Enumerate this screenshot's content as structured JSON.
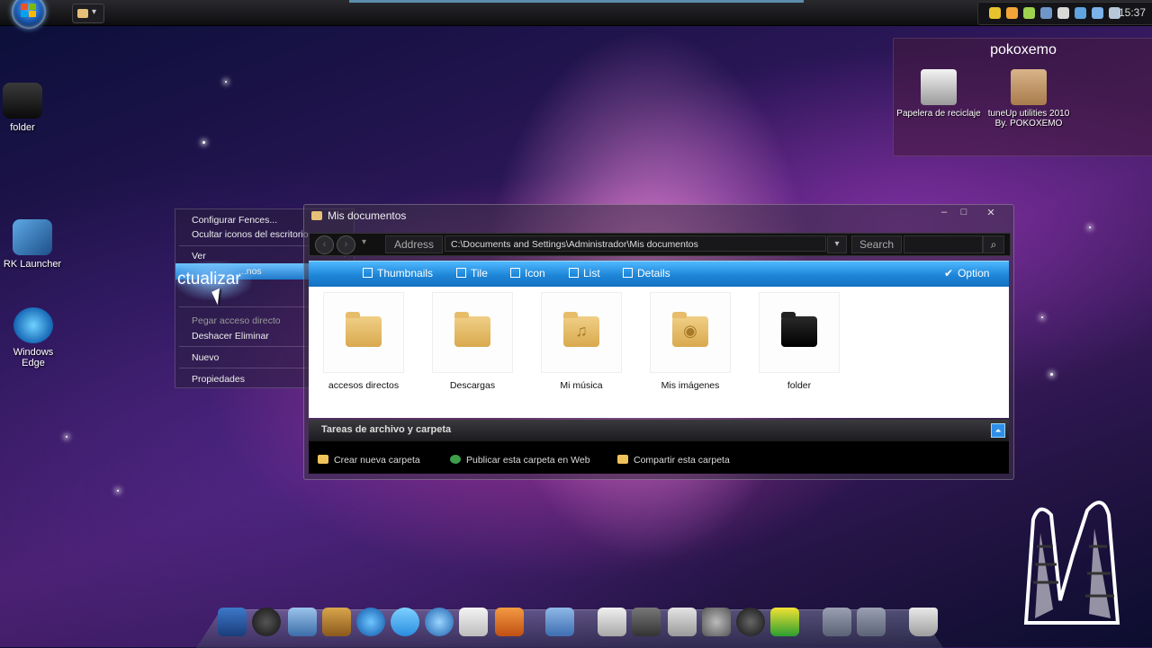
{
  "taskbar": {
    "start_icon": "windows-start-orb",
    "quick_launch_icon": "folder-icon",
    "tray_icons": [
      "shield-icon",
      "network-icon",
      "star-icon",
      "speaker-icon",
      "skype-icon",
      "chrome-icon",
      "flag-icon",
      "monitor-icon"
    ],
    "clock": "15:37"
  },
  "desktop": {
    "icons": [
      {
        "label": "folder",
        "icon": "apple-folder-icon"
      },
      {
        "label": "RK Launcher",
        "icon": "rk-launcher-icon"
      },
      {
        "label": "Windows Edge",
        "icon": "windows-edge-icon"
      }
    ]
  },
  "fence": {
    "title": "pokoxemo",
    "items": [
      {
        "label": "Papelera de reciclaje",
        "icon": "recycle-bin-icon"
      },
      {
        "label": "tuneUp utilities 2010",
        "label2": "By. POKOXEMO",
        "icon": "package-icon"
      }
    ]
  },
  "context_menu": {
    "items": [
      {
        "label": "Configurar Fences..."
      },
      {
        "label": "Ocultar iconos del escritorio"
      },
      {
        "label": "Ver"
      },
      {
        "label": "...nos"
      },
      {
        "label": "Pegar acceso directo"
      },
      {
        "label": "Deshacer Eliminar"
      },
      {
        "label": "Nuevo"
      },
      {
        "label": "Propiedades"
      }
    ],
    "overlay_text": "ctualizar"
  },
  "explorer": {
    "title": "Mis documentos",
    "window_buttons": {
      "minimize": "–",
      "maximize": "□",
      "close": "✕"
    },
    "address_label": "Address",
    "address_value": "C:\\Documents and Settings\\Administrador\\Mis documentos",
    "search_label": "Search",
    "views": [
      {
        "label": "Thumbnails",
        "icon": "thumbnails-icon"
      },
      {
        "label": "Tile",
        "icon": "tile-icon"
      },
      {
        "label": "Icon",
        "icon": "icon-view-icon"
      },
      {
        "label": "List",
        "icon": "list-icon"
      },
      {
        "label": "Details",
        "icon": "details-icon"
      }
    ],
    "option_label": "Option",
    "files": [
      {
        "label": "accesos directos",
        "icon": "folder-icon"
      },
      {
        "label": "Descargas",
        "icon": "folder-icon"
      },
      {
        "label": "Mi música",
        "icon": "music-folder-icon"
      },
      {
        "label": "Mis imágenes",
        "icon": "pictures-folder-icon"
      },
      {
        "label": "folder",
        "icon": "apple-folder-icon"
      }
    ],
    "tasks_title": "Tareas de archivo y carpeta",
    "tasks": [
      {
        "label": "Crear nueva carpeta",
        "icon": "new-folder-icon"
      },
      {
        "label": "Publicar esta carpeta en Web",
        "icon": "globe-icon"
      },
      {
        "label": "Compartir esta carpeta",
        "icon": "share-folder-icon"
      }
    ]
  },
  "dock": {
    "icons": [
      "dashboard-icon",
      "clock-icon",
      "mail-stamp-icon",
      "address-book-icon",
      "media-player-icon",
      "messenger-icon",
      "browser-icon",
      "notepad-icon",
      "utility-icon",
      "documents-icon",
      "scissors-icon",
      "hanger-icon",
      "calculator-icon",
      "settings-icon",
      "power-icon",
      "equalizer-icon",
      "downloads-icon",
      "stack-icon",
      "trash-icon"
    ]
  }
}
